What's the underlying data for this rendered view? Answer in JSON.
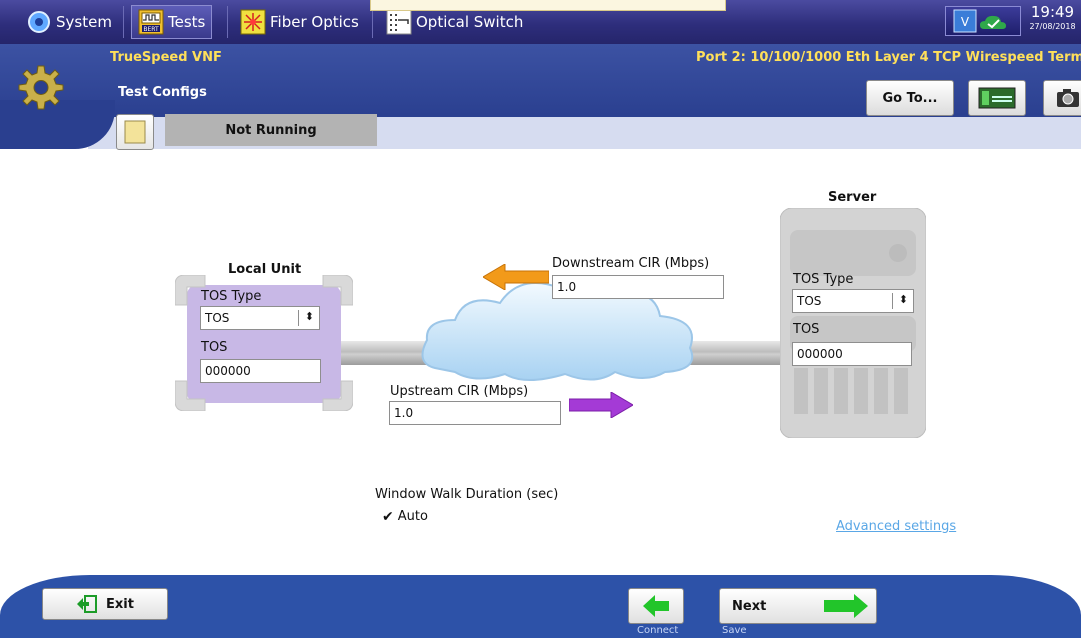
{
  "topbar": {
    "tabs": [
      {
        "label": "System",
        "icon": "gear-icon"
      },
      {
        "label": "Tests",
        "icon": "bert-icon",
        "icon_text": "BERT"
      },
      {
        "label": "Fiber Optics",
        "icon": "laser-icon"
      },
      {
        "label": "Optical Switch",
        "icon": "optical-switch-icon"
      }
    ],
    "time": "19:49",
    "date": "27/08/2018"
  },
  "header": {
    "app_name": "TrueSpeed VNF",
    "page_name": "Test Configs",
    "port_text": "Port 2: 10/100/1000 Eth Layer 4 TCP Wirespeed Term",
    "goto_label": "Go To...",
    "run_status": "Not Running"
  },
  "diagram": {
    "local_unit": {
      "title": "Local Unit",
      "tos_type_label": "TOS Type",
      "tos_type_value": "TOS",
      "tos_label": "TOS",
      "tos_value": "000000"
    },
    "server": {
      "title": "Server",
      "tos_type_label": "TOS Type",
      "tos_type_value": "TOS",
      "tos_label": "TOS",
      "tos_value": "000000"
    },
    "downstream": {
      "label": "Downstream CIR (Mbps)",
      "value": "1.0",
      "arrow_color": "#f29a1a"
    },
    "upstream": {
      "label": "Upstream CIR (Mbps)",
      "value": "1.0",
      "arrow_color": "#a43ad6"
    }
  },
  "window_walk": {
    "label": "Window Walk Duration (sec)",
    "auto_label": "Auto",
    "auto_checked": true
  },
  "advanced_link": "Advanced settings",
  "footer": {
    "exit_label": "Exit",
    "back_sub": "Connect",
    "next_label": "Next",
    "next_sub": "Save"
  },
  "colors": {
    "topbar": "#2e2e7c",
    "header": "#2a3f8f",
    "app_name": "#ffe05a",
    "link": "#5aa7e6",
    "nav_arrow": "#22c52a"
  }
}
